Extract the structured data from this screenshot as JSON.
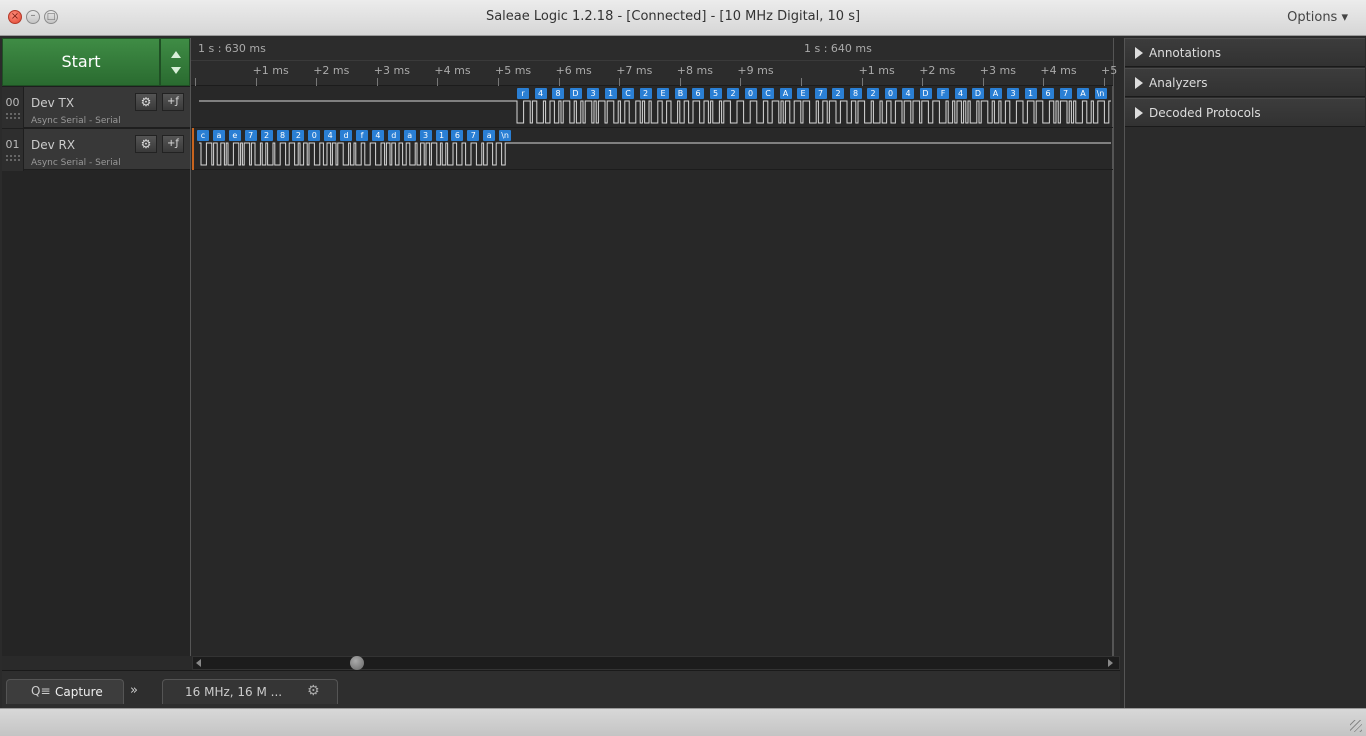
{
  "window": {
    "title": "Saleae Logic 1.2.18 - [Connected] - [10 MHz Digital, 10 s]",
    "options_label": "Options ▾"
  },
  "controls": {
    "start_label": "Start"
  },
  "channels": [
    {
      "number": "00",
      "name": "Dev TX",
      "analyzer": "Async Serial - Serial"
    },
    {
      "number": "01",
      "name": "Dev RX",
      "analyzer": "Async Serial - Serial"
    }
  ],
  "ruler": {
    "group1": "1 s : 630 ms",
    "group2": "1 s : 640 ms",
    "ticks1": [
      "+1 ms",
      "+2 ms",
      "+3 ms",
      "+4 ms",
      "+5 ms",
      "+6 ms",
      "+7 ms",
      "+8 ms",
      "+9 ms"
    ],
    "ticks2": [
      "+1 ms",
      "+2 ms",
      "+3 ms",
      "+4 ms",
      "+5"
    ]
  },
  "decoded": {
    "tx": [
      "r",
      "4",
      "8",
      "D",
      "3",
      "1",
      "C",
      "2",
      "E",
      "B",
      "6",
      "5",
      "2",
      "0",
      "C",
      "A",
      "E",
      "7",
      "2",
      "8",
      "2",
      "0",
      "4",
      "D",
      "F",
      "4",
      "D",
      "A",
      "3",
      "1",
      "6",
      "7",
      "A",
      "\\n"
    ],
    "rx": [
      "c",
      "a",
      "e",
      "7",
      "2",
      "8",
      "2",
      "0",
      "4",
      "d",
      "f",
      "4",
      "d",
      "a",
      "3",
      "1",
      "6",
      "7",
      "a",
      "\\n"
    ]
  },
  "bottom": {
    "capture_label": "Capture",
    "settings_label": "16 MHz, 16 M ..."
  },
  "right_panel": {
    "sections": [
      "Annotations",
      "Analyzers",
      "Decoded Protocols"
    ]
  },
  "colors": {
    "start_green": "#2f7a35",
    "bubble_blue": "#2a7fd4",
    "marker_orange": "#c8641e"
  }
}
